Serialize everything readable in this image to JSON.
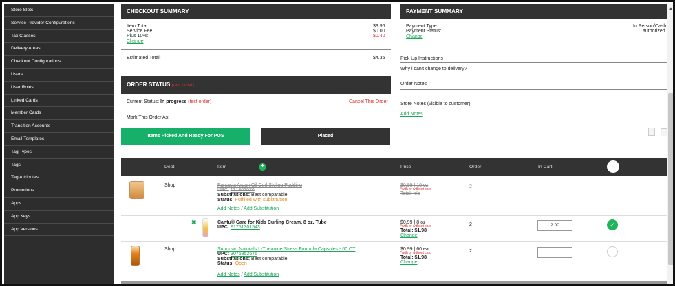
{
  "sidebar": {
    "items": [
      {
        "label": "Store Slots"
      },
      {
        "label": "Service Provider Configurations"
      },
      {
        "label": "Tax Classes"
      },
      {
        "label": "Delivery Areas"
      },
      {
        "label": "Checkout Configurations"
      },
      {
        "label": "Users"
      },
      {
        "label": "User Roles"
      },
      {
        "label": "Linked Cards"
      },
      {
        "label": "Member Cards"
      },
      {
        "label": "Transition Accounts"
      },
      {
        "label": "Email Templates"
      },
      {
        "label": "Tag Types"
      },
      {
        "label": "Tags"
      },
      {
        "label": "Tag Attributes"
      },
      {
        "label": "Promotions"
      },
      {
        "label": "Apps"
      },
      {
        "label": "App Keys"
      },
      {
        "label": "App Versions"
      }
    ]
  },
  "checkout": {
    "title": "CHECKOUT SUMMARY",
    "item_total_label": "Item Total:",
    "item_total": "$3.96",
    "service_fee_label": "Service Fee:",
    "service_fee": "$0.00",
    "plus_label": "Plus 10%:",
    "plus_value": "$0.40",
    "change_link": "Change",
    "estimated_label": "Estimated Total:",
    "estimated_total": "$4.36"
  },
  "payment": {
    "title": "PAYMENT SUMMARY",
    "type_label": "Payment Type:",
    "type_value": "In Person/Cash",
    "status_label": "Payment Status:",
    "status_value": "authorized",
    "change_link": "Change",
    "pickup_heading": "Pick Up Instructions",
    "pickup_question": "Why i can't change to delivery?",
    "order_notes_heading": "Order Notes",
    "store_notes_heading": "Store Notes",
    "store_notes_sub": "(visible to customer)",
    "add_notes_link": "Add Notes"
  },
  "order_status": {
    "title": "ORDER STATUS",
    "title_tag": "(test order)",
    "current_label": "Current Status:",
    "current_value": "In progress",
    "current_tag": "(test order)",
    "cancel_link": "Cancel This Order",
    "mark_label": "Mark This Order As:",
    "btn_picked": "Items Picked And Ready For POS",
    "btn_placed": "Placed"
  },
  "table": {
    "headers": {
      "dept": "Dept.",
      "item": "Item",
      "price": "Price",
      "order": "Order",
      "in_cart": "In Cart"
    },
    "rows": [
      {
        "dept": "Shop",
        "name": "Fantasia Argan Oil Curl Styling Pudding",
        "upc_label": "UPC:",
        "upc": "131302070",
        "subs_label": "Substitutions:",
        "subs_value": "Best comparable",
        "status_label": "Status:",
        "status_value": "Fulfilled with substitution",
        "add_notes": "Add Notes",
        "separator": "/",
        "add_sub": "Add Substitution",
        "price": "$0.99 | 16 oz",
        "price_note": "*with or without card",
        "total": "Total: n/a",
        "order": "2"
      },
      {
        "name": "Cantu® Care for Kids Curling Cream, 8 oz. Tube",
        "upc_label": "UPC:",
        "upc": "81751301543",
        "price": "$0.99 | 8 oz",
        "price_note": "*with or without card",
        "total": "Total: $1.98",
        "change": "Change",
        "order": "2",
        "in_cart": "2.00"
      },
      {
        "dept": "Shop",
        "name": "Sundown Naturals L-Theanine Stress Formula Capsules - 60 CT",
        "upc_label": "UPC:",
        "upc": "3076852676",
        "subs_label": "Substitutions:",
        "subs_value": "Best comparable",
        "status_label": "Status:",
        "status_value": "Open",
        "add_notes": "Add Notes",
        "separator": "/",
        "add_sub": "Add Substitution",
        "price": "$0.99 | 60 ea",
        "price_note": "*with or without card",
        "total": "Total: $1.98",
        "change": "Change",
        "order": "2",
        "in_cart": ""
      }
    ]
  },
  "colors": {
    "sidebar_bg": "#2d2d2d",
    "header_bg": "#333333",
    "green": "#17b06b",
    "red": "#d9332b",
    "orange": "#e58a1f"
  }
}
